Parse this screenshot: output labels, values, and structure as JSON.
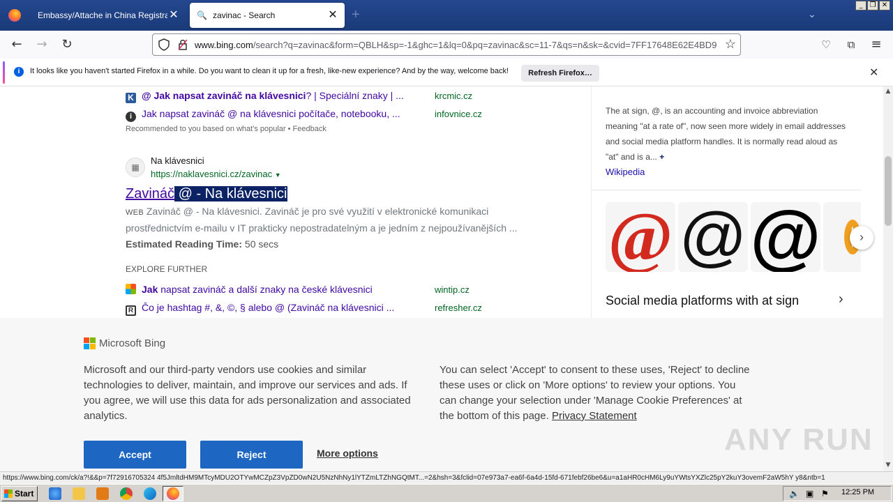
{
  "browser": {
    "tabs": [
      {
        "label": "Embassy/Attache in China Registration",
        "active": false
      },
      {
        "label": "zavinac - Search",
        "active": true
      }
    ],
    "url_domain": "www.bing.com",
    "url_rest": "/search?q=zavinac&form=QBLH&sp=-1&ghc=1&lq=0&pq=zavinac&sc=11-7&qs=n&sk=&cvid=7FF17648E62E4BD9",
    "status_url": "https://www.bing.com/ck/a?!&&p=7f72916705324 4f5JmltdHM9MTcyMDU2OTYwMCZpZ3VpZD0wN2U5NzNhNy1lYTZmLTZhNGQtMT...=2&hsh=3&fclid=07e973a7-ea6f-6a4d-15fd-671febf26be6&u=a1aHR0cHM6Ly9uYWtsYXZlc25pY2kuY3ovemF2aW5hY y8&ntb=1"
  },
  "notification": {
    "text": "It looks like you haven't started Firefox in a while. Do you want to clean it up for a fresh, like-new experience? And by the way, welcome back!",
    "button": "Refresh Firefox…"
  },
  "results_top": [
    {
      "title_bold": "@ Jak napsat zavináč na klávesnici",
      "title_rest": "? | Speciální znaky | ...",
      "domain": "krcmic.cz",
      "icon_color": "#2b5a9e",
      "icon_text": "K"
    },
    {
      "title_bold": "",
      "title_rest": "Jak napsat zavináč @ na klávesnici počítače, notebooku, ...",
      "domain": "infovnice.cz",
      "icon_color": "#333333",
      "icon_text": "i"
    }
  ],
  "recommended": "Recommended to you based on what's popular • Feedback",
  "main_result": {
    "site_name": "Na klávesnici",
    "site_url": "https://naklavesnici.cz/zavinac",
    "title_plain": "Zavináč",
    "title_selected": " @ - Na klávesnici",
    "web_label": "WEB",
    "snippet": "Zavináč @ - Na klávesnici. Zavináč je pro své využití v elektronické komunikaci prostřednictvím e-mailu v IT prakticky nepostradatelným a je jedním z nejpoužívanějších ...",
    "reading_label": "Estimated Reading Time:",
    "reading_value": "50 secs"
  },
  "explore_label": "EXPLORE FURTHER",
  "explore": [
    {
      "bold": "Jak",
      "rest": " napsat zavináč a další znaky na české klávesnici",
      "domain": "wintip.cz"
    },
    {
      "bold": "",
      "rest": "Čo je hashtag #, &, ©, § alebo @ (Zavináč na klávesnici ...",
      "domain": "refresher.cz"
    }
  ],
  "sidebar": {
    "description": "The at sign, @, is an accounting and invoice abbreviation meaning \"at a rate of\", now seen more widely in email addresses and social media platform handles. It is normally read aloud as \"at\" and is a...",
    "more": "+",
    "wiki": "Wikipedia",
    "images": [
      "@",
      "@",
      "@"
    ],
    "social_heading": "Social media platforms with at sign"
  },
  "cookie": {
    "brand": "Microsoft Bing",
    "left_text": "Microsoft and our third-party vendors use cookies and similar technologies to deliver, maintain, and improve our services and ads. If you agree, we will use this data for ads personalization and associated analytics.",
    "right_text": "You can select 'Accept' to consent to these uses, 'Reject' to decline these uses or click on 'More options' to review your options. You can change your selection under 'Manage Cookie Preferences' at the bottom of this page.",
    "privacy_link": "Privacy Statement",
    "accept": "Accept",
    "reject": "Reject",
    "more": "More options",
    "watermark": "ANY RUN"
  },
  "taskbar": {
    "start": "Start",
    "clock": "12:25 PM"
  },
  "colors": {
    "bing_blue": "#1d66c1",
    "link_purple": "#4007a2",
    "url_green": "#006621",
    "firefox_tabbar": "#1c3c7a"
  }
}
